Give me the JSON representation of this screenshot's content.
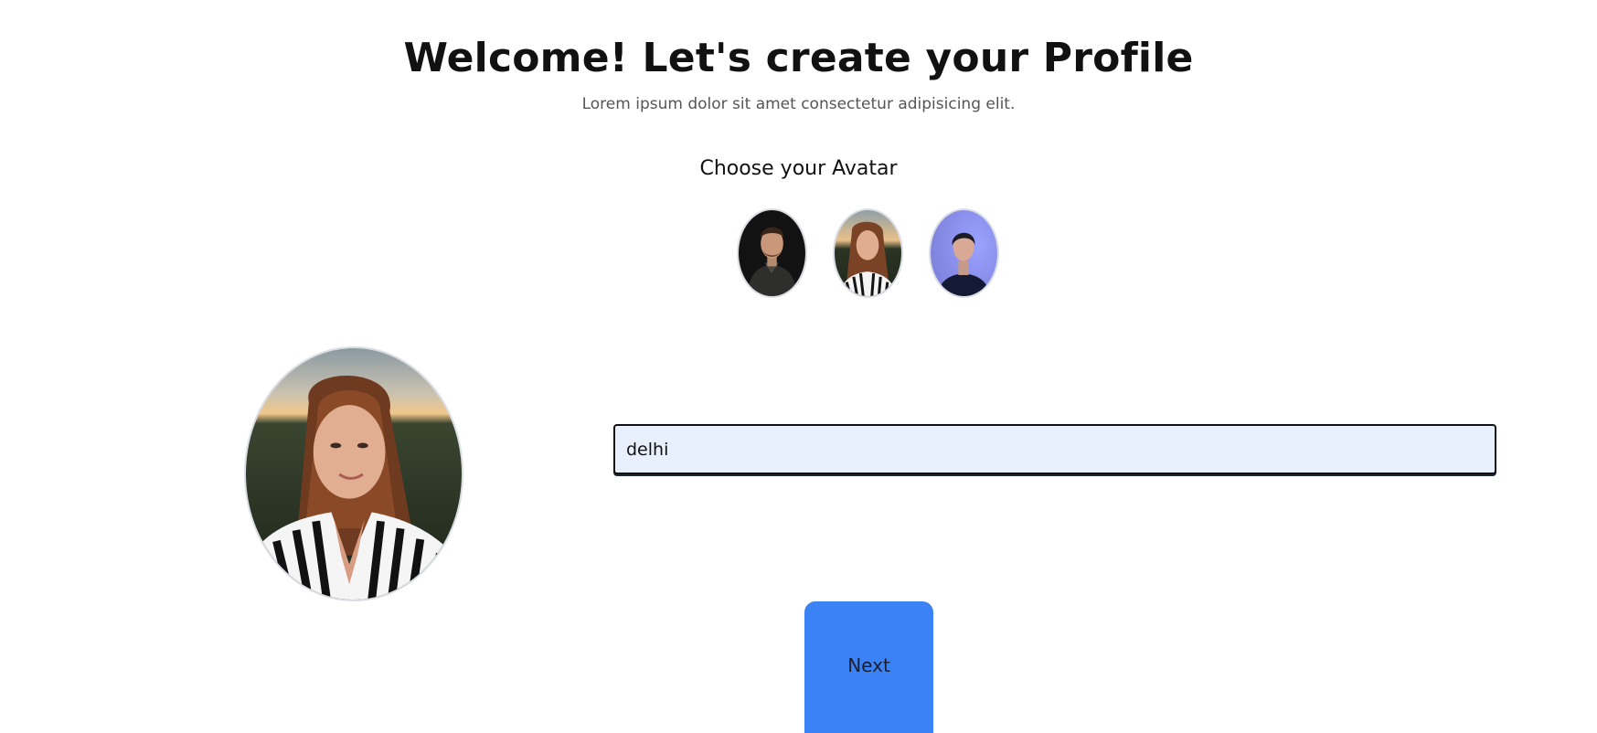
{
  "header": {
    "title": "Welcome! Let's create your Profile",
    "subtitle": "Lorem ipsum dolor sit amet consectetur adipisicing elit."
  },
  "avatar_picker": {
    "heading": "Choose your Avatar",
    "options": [
      {
        "icon": "avatar-man-dark-sweater"
      },
      {
        "icon": "avatar-woman-striped-shirt"
      },
      {
        "icon": "avatar-woman-blue-light"
      }
    ],
    "selected_index": 1
  },
  "form": {
    "city_input": {
      "value": "delhi",
      "placeholder": ""
    }
  },
  "actions": {
    "next_label": "Next"
  },
  "colors": {
    "accent": "#3b82f6",
    "input_bg": "#e8f0fe"
  }
}
